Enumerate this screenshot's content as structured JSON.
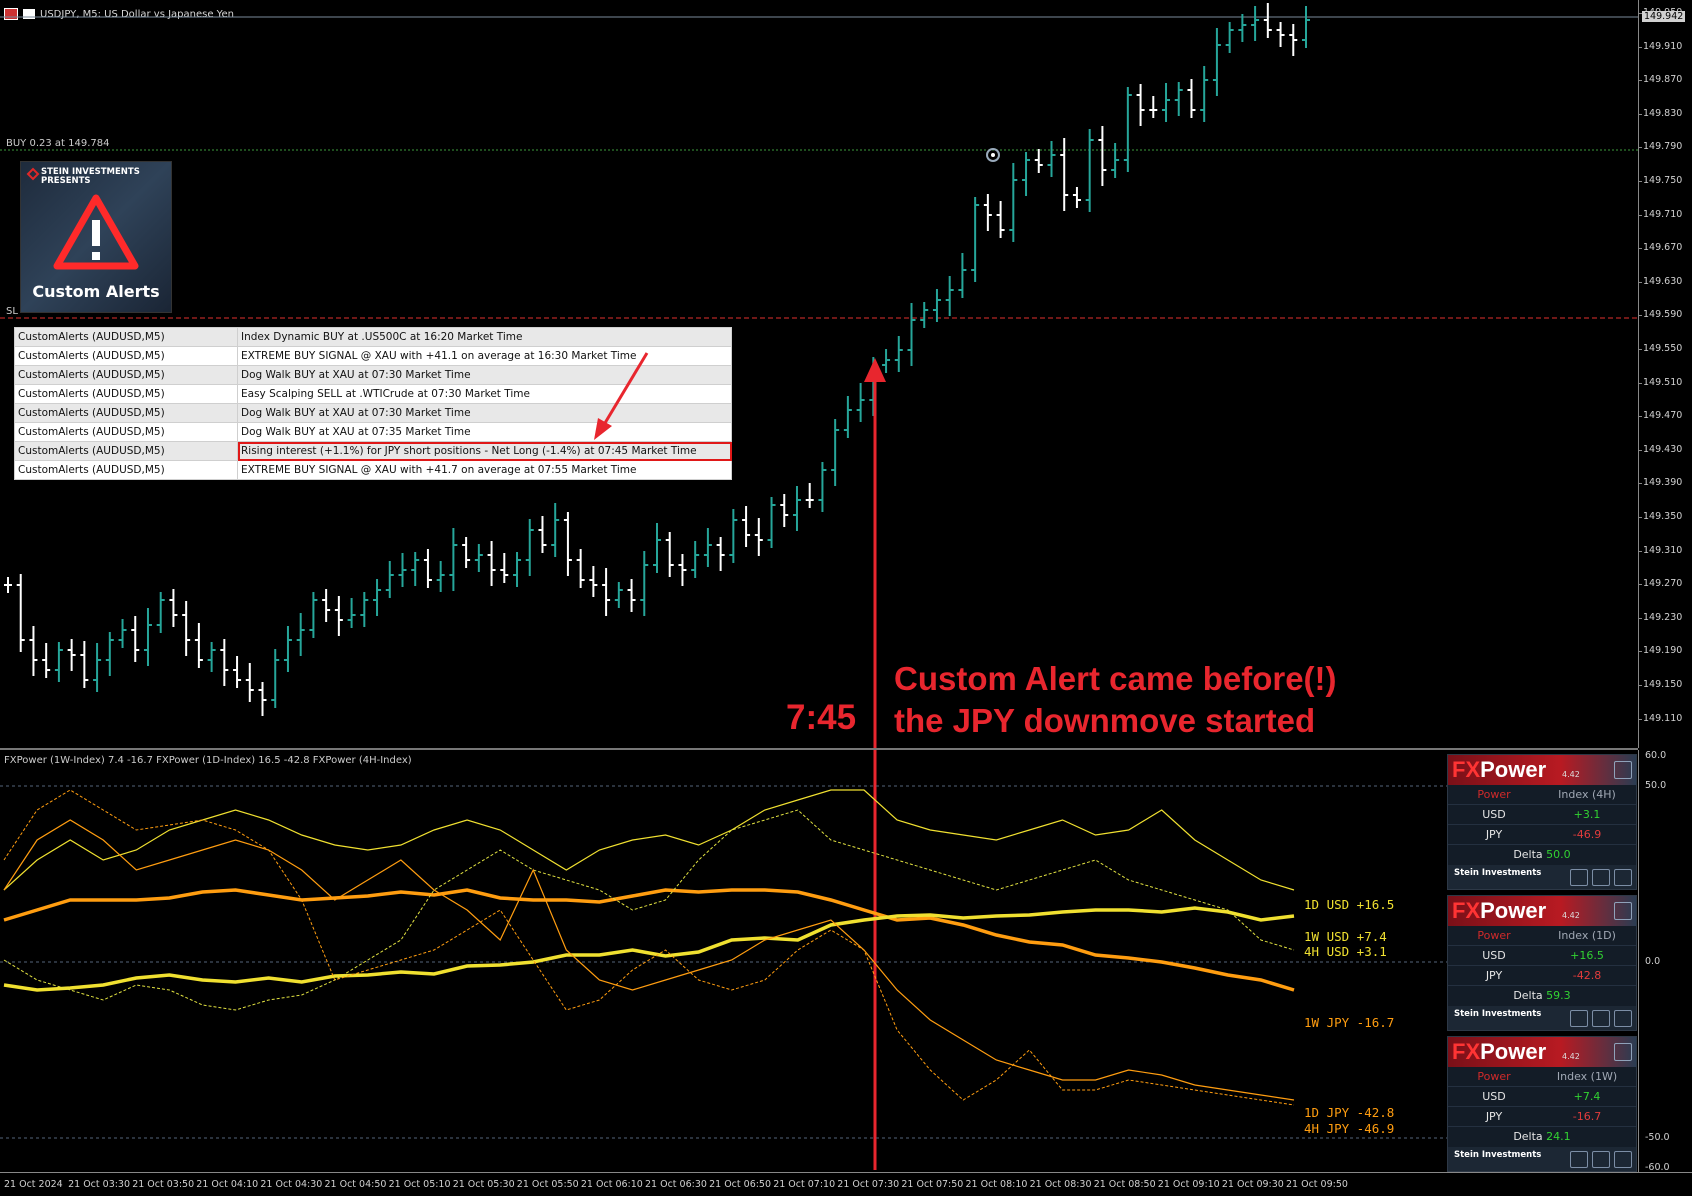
{
  "header": {
    "symbol_title": "USDJPY, M5:  US Dollar vs Japanese Yen"
  },
  "price_axis": {
    "ticks": [
      "149.950",
      "149.910",
      "149.870",
      "149.830",
      "149.790",
      "149.750",
      "149.710",
      "149.670",
      "149.630",
      "149.590",
      "149.550",
      "149.510",
      "149.470",
      "149.430",
      "149.390",
      "149.350",
      "149.310",
      "149.270",
      "149.230",
      "149.190",
      "149.150",
      "149.110"
    ],
    "current_price": "149.942"
  },
  "chart": {
    "buy_line_label": "BUY 0.23 at 149.784",
    "sl_label": "SL",
    "colors": {
      "bull": "#26a69a",
      "bear": "#ffffff",
      "buy_line": "#3c9a3c",
      "sl_line": "#e0302e"
    }
  },
  "logo": {
    "brand": "STEIN INVESTMENTS",
    "sub": "PRESENTS",
    "title": "Custom Alerts"
  },
  "alerts": [
    {
      "source": "CustomAlerts (AUDUSD,M5)",
      "message": "Index Dynamic BUY at .US500C at 16:20 Market Time"
    },
    {
      "source": "CustomAlerts (AUDUSD,M5)",
      "message": "EXTREME BUY SIGNAL @ XAU with +41.1 on average at 16:30 Market Time"
    },
    {
      "source": "CustomAlerts (AUDUSD,M5)",
      "message": "Dog Walk BUY at XAU at 07:30 Market Time"
    },
    {
      "source": "CustomAlerts (AUDUSD,M5)",
      "message": "Easy Scalping SELL at .WTICrude at 07:30 Market Time"
    },
    {
      "source": "CustomAlerts (AUDUSD,M5)",
      "message": "Dog Walk BUY at XAU at 07:30 Market Time"
    },
    {
      "source": "CustomAlerts (AUDUSD,M5)",
      "message": "Dog Walk BUY at XAU at 07:35 Market Time"
    },
    {
      "source": "CustomAlerts (AUDUSD,M5)",
      "message": "Rising interest (+1.1%) for JPY short positions - Net Long (-1.4%) at 07:45 Market Time"
    },
    {
      "source": "CustomAlerts (AUDUSD,M5)",
      "message": "EXTREME BUY SIGNAL @ XAU with +41.7 on average at 07:55 Market Time"
    }
  ],
  "annotation": {
    "time_label": "7:45",
    "line1": "Custom Alert came before(!)",
    "line2": "the JPY downmove started",
    "color": "#e8262e"
  },
  "indicator": {
    "title": "FXPower (1W-Index) 7.4 -16.7 FXPower (1D-Index) 16.5 -42.8 FXPower (4H-Index)",
    "axis_ticks": [
      "60.0",
      "50.0",
      "0.0",
      "-50.0",
      "-60.0"
    ],
    "labels": [
      {
        "text": "1D USD +16.5",
        "color": "#f0e030"
      },
      {
        "text": "1W USD  +7.4",
        "color": "#f0e030"
      },
      {
        "text": "4H USD  +3.1",
        "color": "#f0e030"
      },
      {
        "text": "1W JPY -16.7",
        "color": "#ff9d10"
      },
      {
        "text": "1D JPY -42.8",
        "color": "#ff9d10"
      },
      {
        "text": "4H JPY -46.9",
        "color": "#ff9d10"
      }
    ]
  },
  "fxpower_panels": [
    {
      "brand_fx": "FX",
      "brand_power": "Power",
      "version": "4.42",
      "col1": "Power",
      "col2": "Index (4H)",
      "rows": [
        {
          "cur": "USD",
          "val": "+3.1"
        },
        {
          "cur": "JPY",
          "val": "-46.9"
        }
      ],
      "delta_label": "Delta",
      "delta_value": "50.0",
      "footer": "Stein Investments"
    },
    {
      "brand_fx": "FX",
      "brand_power": "Power",
      "version": "4.42",
      "col1": "Power",
      "col2": "Index (1D)",
      "rows": [
        {
          "cur": "USD",
          "val": "+16.5"
        },
        {
          "cur": "JPY",
          "val": "-42.8"
        }
      ],
      "delta_label": "Delta",
      "delta_value": "59.3",
      "footer": "Stein Investments"
    },
    {
      "brand_fx": "FX",
      "brand_power": "Power",
      "version": "4.42",
      "col1": "Power",
      "col2": "Index (1W)",
      "rows": [
        {
          "cur": "USD",
          "val": "+7.4"
        },
        {
          "cur": "JPY",
          "val": "-16.7"
        }
      ],
      "delta_label": "Delta",
      "delta_value": "24.1",
      "footer": "Stein Investments"
    }
  ],
  "time_axis": [
    "21 Oct 2024",
    "21 Oct 03:30",
    "21 Oct 03:50",
    "21 Oct 04:10",
    "21 Oct 04:30",
    "21 Oct 04:50",
    "21 Oct 05:10",
    "21 Oct 05:30",
    "21 Oct 05:50",
    "21 Oct 06:10",
    "21 Oct 06:30",
    "21 Oct 06:50",
    "21 Oct 07:10",
    "21 Oct 07:30",
    "21 Oct 07:50",
    "21 Oct 08:10",
    "21 Oct 08:30",
    "21 Oct 08:50",
    "21 Oct 09:10",
    "21 Oct 09:30",
    "21 Oct 09:50"
  ]
}
